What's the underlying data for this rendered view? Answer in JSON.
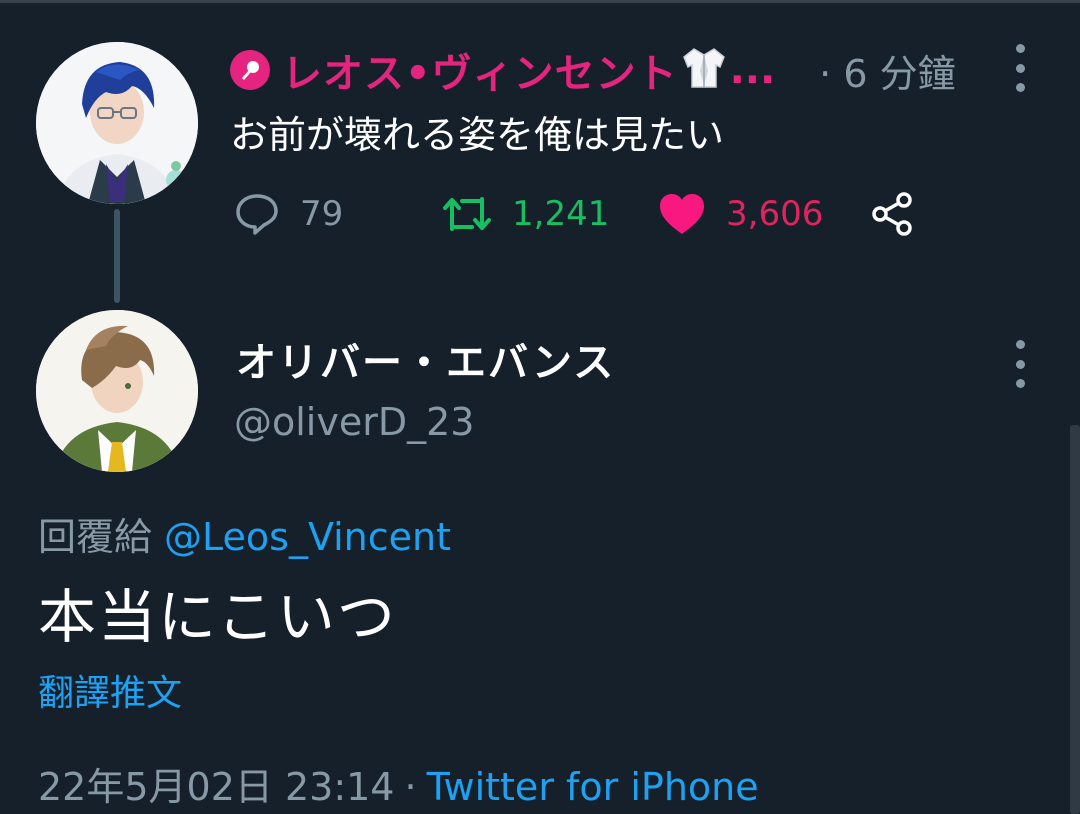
{
  "tweet1": {
    "display_name": "レオス•ヴィンセント",
    "ellipsis": "...",
    "time_ago": "· 6 分鐘",
    "text": "お前が壊れる姿を俺は見たい",
    "reply_count": "79",
    "retweet_count": "1,241",
    "like_count": "3,606",
    "badge_icon": "microphone-icon",
    "name_emoji": "lab-coat-icon"
  },
  "tweet2": {
    "display_name": "オリバー・エバンス",
    "handle": "@oliverD_23",
    "replying_to_label": "回覆給",
    "replying_to_mention": "@Leos_Vincent",
    "text": "本当にこいつ",
    "translate_label": "翻譯推文",
    "date": "22年5月02日 23:14",
    "separator": "·",
    "source": "Twitter for iPhone"
  },
  "colors": {
    "background": "#15202b",
    "accent_pink": "#e5247f",
    "retweet_green": "#17bf63",
    "like_red": "#e0245e",
    "link_blue": "#1da1f2",
    "muted_gray": "#8899a6"
  }
}
